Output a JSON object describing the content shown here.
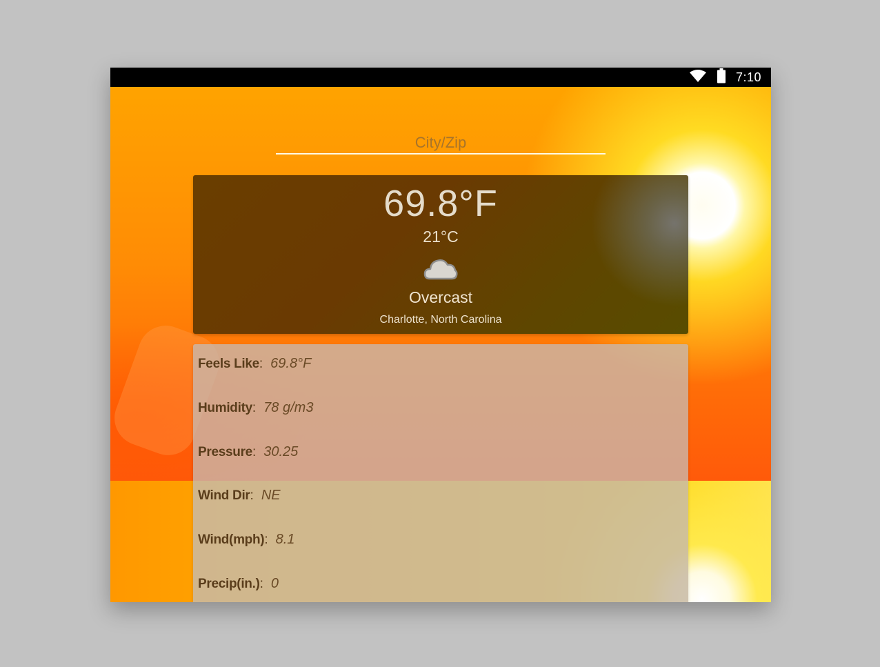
{
  "status_bar": {
    "time": "7:10",
    "wifi_icon": "wifi-icon",
    "battery_icon": "battery-icon"
  },
  "search": {
    "placeholder": "City/Zip",
    "value": ""
  },
  "current": {
    "temp_f": "69.8°F",
    "temp_c": "21°C",
    "condition_icon": "cloud-icon",
    "condition": "Overcast",
    "location": "Charlotte, North Carolina"
  },
  "details": [
    {
      "label": "Feels Like",
      "value": "69.8°F"
    },
    {
      "label": "Humidity",
      "value": "78 g/m3"
    },
    {
      "label": "Pressure",
      "value": "30.25"
    },
    {
      "label": "Wind Dir",
      "value": "NE"
    },
    {
      "label": "Wind(mph)",
      "value": "8.1"
    },
    {
      "label": "Precip(in.)",
      "value": "0"
    }
  ],
  "colors": {
    "background_orange": "#ff9a00",
    "card_dark": "#6a3e00",
    "text_light": "#e9dcc4",
    "detail_label": "#5a3d1b"
  }
}
